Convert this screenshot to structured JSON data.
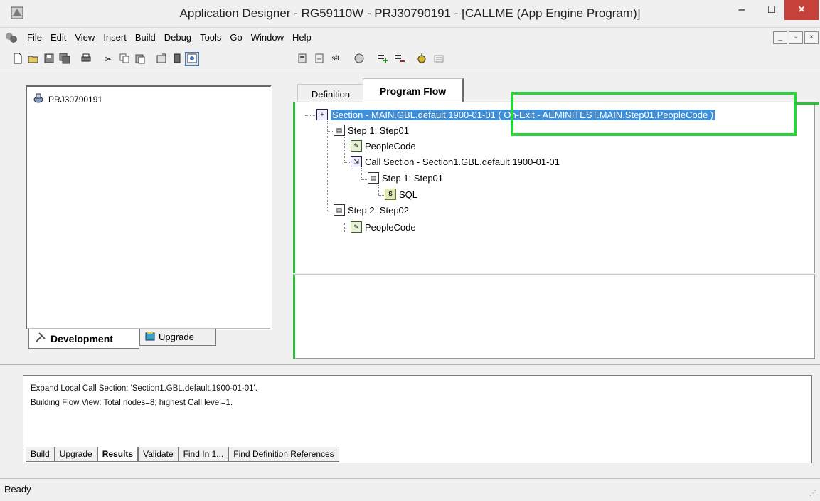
{
  "window": {
    "title": "Application Designer - RG59110W - PRJ30790191 - [CALLME (App Engine Program)]",
    "minimize": "–",
    "maximize": "□",
    "close": "×"
  },
  "menu": {
    "items": [
      "File",
      "Edit",
      "View",
      "Insert",
      "Build",
      "Debug",
      "Tools",
      "Go",
      "Window",
      "Help"
    ],
    "mdi_minimize": "_",
    "mdi_restore": "▫",
    "mdi_close": "×"
  },
  "toolbar": {
    "icons": [
      "new-icon",
      "open-icon",
      "save-icon",
      "save-all-icon",
      "print-icon",
      "cut-icon",
      "copy-icon",
      "paste-icon",
      "properties-icon",
      "project-icon",
      "project-workspace-icon",
      "section-icon",
      "step-icon",
      "sql-icon",
      "peoplecode-icon",
      "insert-step-icon",
      "delete-step-icon",
      "run-icon",
      "log-icon"
    ]
  },
  "project": {
    "name": "PRJ30790191"
  },
  "left_tabs": {
    "development": "Development",
    "upgrade": "Upgrade"
  },
  "editor_tabs": {
    "definition": "Definition",
    "program_flow": "Program Flow"
  },
  "flow_tree": {
    "section": "Section - MAIN.GBL.default.1900-01-01 ( On-Exit - AEMINITEST.MAIN.Step01.PeopleCode )",
    "step1": "Step 1: Step01",
    "step1_peoplecode": "PeopleCode",
    "call_section": "Call Section - Section1.GBL.default.1900-01-01",
    "call_step1": "Step 1: Step01",
    "call_sql": "SQL",
    "step2": "Step 2: Step02",
    "step2_peoplecode": "PeopleCode"
  },
  "output": {
    "lines": [
      "Expand Local Call Section: 'Section1.GBL.default.1900-01-01'.",
      "Building Flow View: Total nodes=8; highest Call level=1."
    ],
    "tabs": [
      "Build",
      "Upgrade",
      "Results",
      "Validate",
      "Find In 1...",
      "Find Definition References"
    ]
  },
  "status": {
    "text": "Ready"
  }
}
